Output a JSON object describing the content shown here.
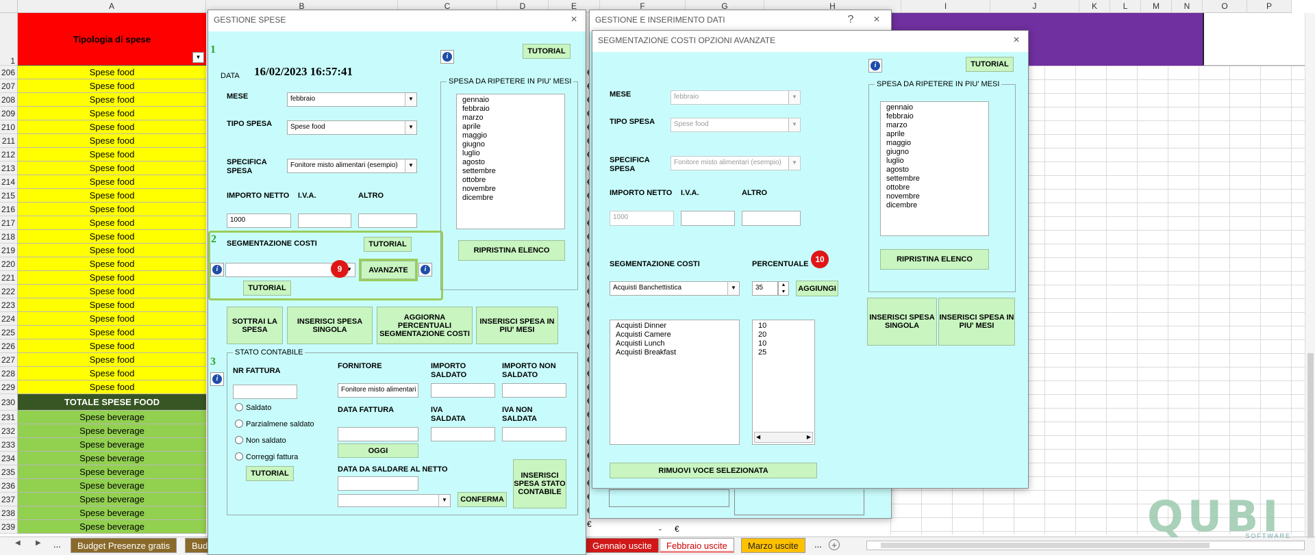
{
  "sheet": {
    "columns": [
      "A",
      "B",
      "C",
      "D",
      "E",
      "F",
      "G",
      "H",
      "I",
      "J",
      "K",
      "L",
      "M",
      "N",
      "O",
      "P"
    ],
    "header_row": "1",
    "header_cell": "Tipologia di spese",
    "rows_food": [
      "206",
      "207",
      "208",
      "209",
      "210",
      "211",
      "212",
      "213",
      "214",
      "215",
      "216",
      "217",
      "218",
      "219",
      "220",
      "221",
      "222",
      "223",
      "224",
      "225",
      "226",
      "227",
      "228",
      "229"
    ],
    "food_label": "Spese food",
    "total_row": "230",
    "total_label": "TOTALE SPESE FOOD",
    "rows_beverage": [
      "231",
      "232",
      "233",
      "234",
      "235",
      "236",
      "237",
      "238",
      "239"
    ],
    "beverage_label": "Spese beverage",
    "euro_sign": "€",
    "bottom_cell": "-",
    "tabs_left": [
      "...",
      "Budget Presenze gratis",
      "Bud"
    ],
    "tabs_right": [
      "Gennaio uscite",
      "Febbraio uscite",
      "Marzo uscite",
      "..."
    ],
    "colors": {
      "header_red": "#ff0000",
      "food_yellow": "#ffff00",
      "total_dark": "#375623",
      "beverage_green": "#92d050",
      "purple": "#7030a0"
    }
  },
  "gestione_spese": {
    "title": "GESTIONE SPESE",
    "close": "×",
    "section_1": "1",
    "section_2": "2",
    "section_3": "3",
    "tutorial": "TUTORIAL",
    "data_label": "DATA",
    "data_value": "16/02/2023 16:57:41",
    "mese_label": "MESE",
    "mese_value": "febbraio",
    "tipo_label": "TIPO SPESA",
    "tipo_value": "Spese food",
    "specifica_label": "SPECIFICA SPESA",
    "specifica_value": "Fonitore misto alimentari (esempio)",
    "importo_label": "IMPORTO NETTO",
    "iva_label": "I.V.A.",
    "altro_label": "ALTRO",
    "importo_value": "1000",
    "ripetere_label": "SPESA DA RIPETERE IN PIU' MESI",
    "months": [
      "gennaio",
      "febbraio",
      "marzo",
      "aprile",
      "maggio",
      "giugno",
      "luglio",
      "agosto",
      "settembre",
      "ottobre",
      "novembre",
      "dicembre"
    ],
    "ripristina": "RIPRISTINA ELENCO",
    "segmentazione_label": "SEGMENTAZIONE COSTI",
    "badge_9": "9",
    "avanzate": "AVANZATE",
    "sottrai": "SOTTRAI LA SPESA",
    "inserisci_singola": "INSERISCI SPESA SINGOLA",
    "aggiorna": "AGGIORNA PERCENTUALI SEGMENTAZIONE COSTI",
    "inserisci_mesi": "INSERISCI SPESA IN PIU' MESI",
    "stato_label": "STATO CONTABILE",
    "nr_fattura": "NR FATTURA",
    "fornitore": "FORNITORE",
    "fornitore_value": "Fonitore misto alimentari",
    "importo_saldato": "IMPORTO SALDATO",
    "importo_non_saldato": "IMPORTO NON SALDATO",
    "radio_saldato": "Saldato",
    "radio_parziale": "Parzialmene saldato",
    "radio_non": "Non saldato",
    "radio_correggi": "Correggi fattura",
    "data_fattura": "DATA FATTURA",
    "iva_saldata": "IVA SALDATA",
    "iva_non_saldata": "IVA NON SALDATA",
    "oggi": "OGGI",
    "data_saldare": "DATA DA SALDARE AL NETTO",
    "conferma": "CONFERMA",
    "inserisci_stato": "INSERISCI SPESA STATO CONTABILE"
  },
  "gestione_dati": {
    "title": "GESTIONE E INSERIMENTO DATI",
    "help": "?",
    "close": "×"
  },
  "segmentazione": {
    "title": "SEGMENTAZIONE COSTI OPZIONI AVANZATE",
    "close": "×",
    "tutorial": "TUTORIAL",
    "mese_label": "MESE",
    "mese_value": "febbraio",
    "tipo_label": "TIPO SPESA",
    "tipo_value": "Spese food",
    "specifica_label": "SPECIFICA SPESA",
    "specifica_value": "Fonitore misto alimentari (esempio)",
    "importo_label": "IMPORTO NETTO",
    "iva_label": "I.V.A.",
    "altro_label": "ALTRO",
    "importo_value": "1000",
    "ripetere_label": "SPESA DA RIPETERE IN PIU' MESI",
    "months": [
      "gennaio",
      "febbraio",
      "marzo",
      "aprile",
      "maggio",
      "giugno",
      "luglio",
      "agosto",
      "settembre",
      "ottobre",
      "novembre",
      "dicembre"
    ],
    "ripristina": "RIPRISTINA ELENCO",
    "segmentazione_label": "SEGMENTAZIONE COSTI",
    "percentuale_label": "PERCENTUALE",
    "badge_10": "10",
    "combo_value": "Acquisti Banchettistica",
    "percent_value": "35",
    "aggiungi": "AGGIUNGI",
    "voci": [
      "Acquisti Dinner",
      "Acquisti Camere",
      "Acquisti Lunch",
      "Acquisti Breakfast"
    ],
    "percentuali": [
      "10",
      "20",
      "10",
      "25"
    ],
    "inserisci_singola": "INSERISCI SPESA SINGOLA",
    "inserisci_mesi": "INSERISCI SPESA IN PIU' MESI",
    "rimuovi": "RIMUOVI VOCE SELEZIONATA"
  },
  "brand": {
    "name": "QUBI",
    "sub": "SOFTWARE"
  }
}
